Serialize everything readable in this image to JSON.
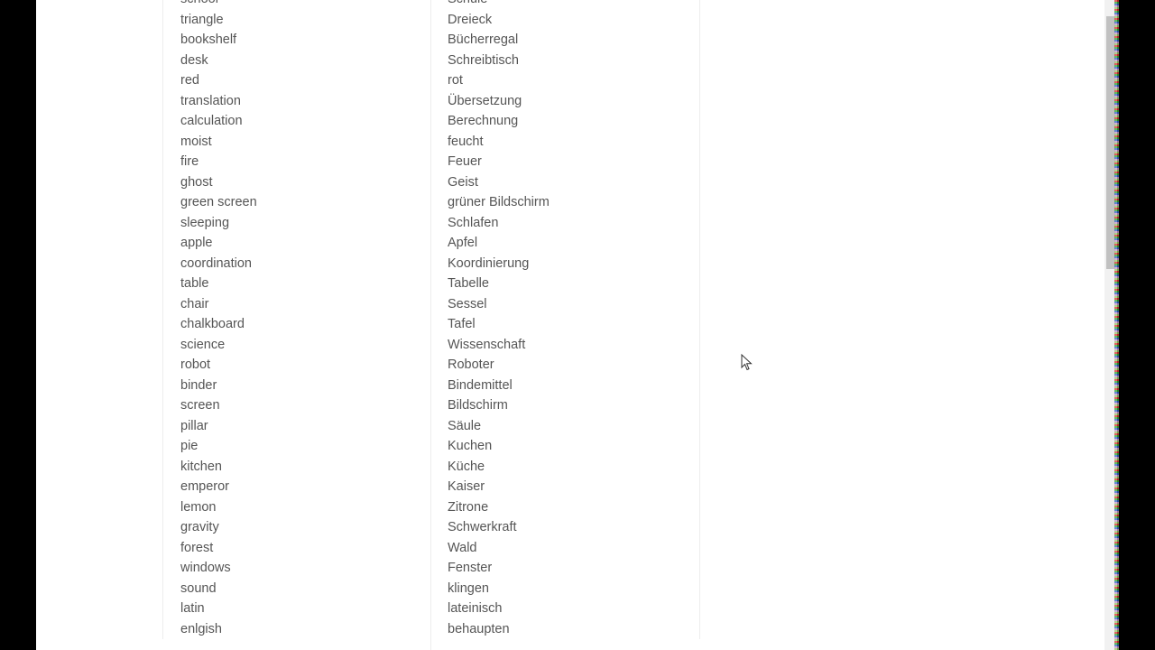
{
  "vocabulary": {
    "rows": [
      {
        "english": "school",
        "german": "Schule"
      },
      {
        "english": "triangle",
        "german": "Dreieck"
      },
      {
        "english": "bookshelf",
        "german": "Bücherregal"
      },
      {
        "english": "desk",
        "german": "Schreibtisch"
      },
      {
        "english": "red",
        "german": "rot"
      },
      {
        "english": "translation",
        "german": "Übersetzung"
      },
      {
        "english": "calculation",
        "german": "Berechnung"
      },
      {
        "english": "moist",
        "german": "feucht"
      },
      {
        "english": "fire",
        "german": "Feuer"
      },
      {
        "english": "ghost",
        "german": "Geist"
      },
      {
        "english": "green screen",
        "german": "grüner Bildschirm"
      },
      {
        "english": "sleeping",
        "german": "Schlafen"
      },
      {
        "english": "apple",
        "german": "Apfel"
      },
      {
        "english": "coordination",
        "german": "Koordinierung"
      },
      {
        "english": "table",
        "german": "Tabelle"
      },
      {
        "english": "chair",
        "german": "Sessel"
      },
      {
        "english": "chalkboard",
        "german": "Tafel"
      },
      {
        "english": "science",
        "german": "Wissenschaft"
      },
      {
        "english": "robot",
        "german": "Roboter"
      },
      {
        "english": "binder",
        "german": "Bindemittel"
      },
      {
        "english": "screen",
        "german": "Bildschirm"
      },
      {
        "english": "pillar",
        "german": "Säule"
      },
      {
        "english": "pie",
        "german": "Kuchen"
      },
      {
        "english": "kitchen",
        "german": "Küche"
      },
      {
        "english": "emperor",
        "german": "Kaiser"
      },
      {
        "english": "lemon",
        "german": "Zitrone"
      },
      {
        "english": "gravity",
        "german": "Schwerkraft"
      },
      {
        "english": "forest",
        "german": "Wald"
      },
      {
        "english": "windows",
        "german": "Fenster"
      },
      {
        "english": "sound",
        "german": "klingen"
      },
      {
        "english": "latin",
        "german": "lateinisch"
      },
      {
        "english": "enlgish",
        "german": "behaupten"
      }
    ]
  },
  "icons": {
    "cursor": "mouse-pointer-icon"
  }
}
